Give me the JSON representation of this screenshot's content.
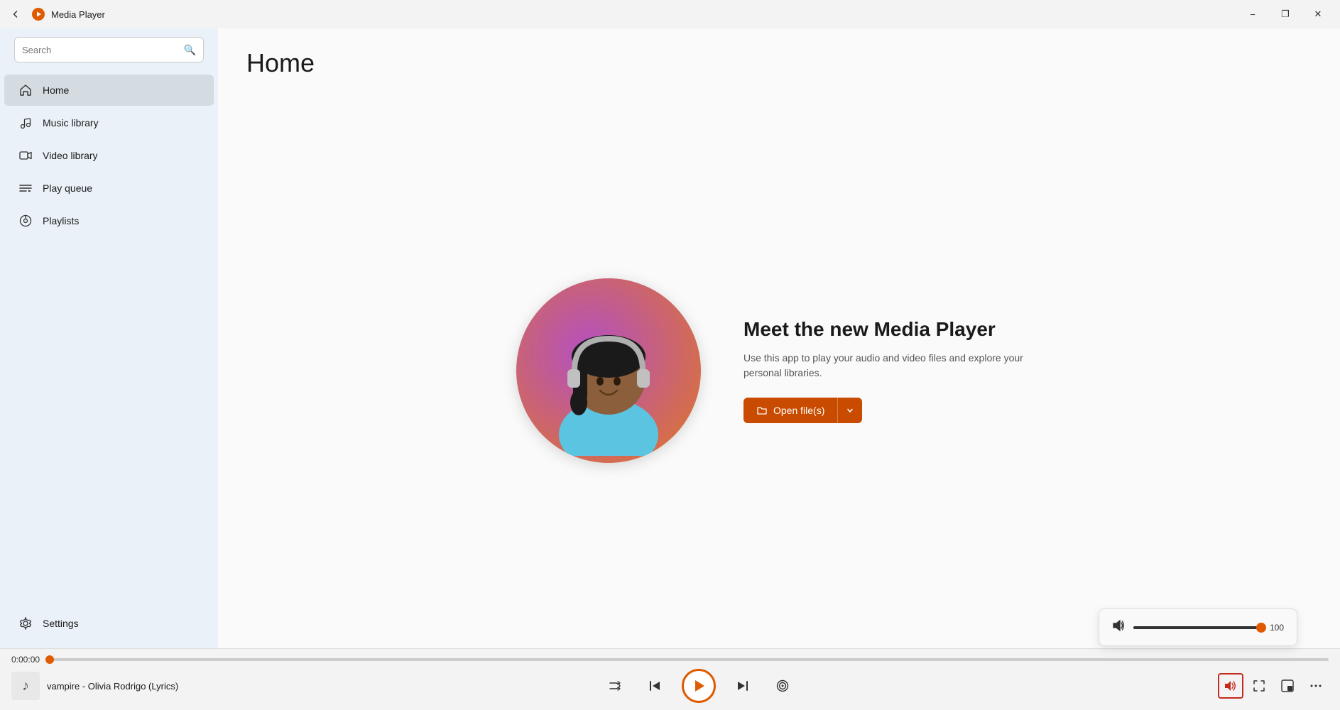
{
  "titlebar": {
    "title": "Media Player",
    "min_label": "−",
    "max_label": "❐",
    "close_label": "✕"
  },
  "sidebar": {
    "search_placeholder": "Search",
    "nav_items": [
      {
        "id": "home",
        "label": "Home",
        "icon": "🏠",
        "active": true
      },
      {
        "id": "music-library",
        "label": "Music library",
        "icon": "🎵",
        "active": false
      },
      {
        "id": "video-library",
        "label": "Video library",
        "icon": "🎞",
        "active": false
      },
      {
        "id": "play-queue",
        "label": "Play queue",
        "icon": "≡",
        "active": false
      },
      {
        "id": "playlists",
        "label": "Playlists",
        "icon": "⊙",
        "active": false
      }
    ],
    "settings_label": "Settings"
  },
  "main": {
    "page_title": "Home",
    "hero": {
      "heading": "Meet the new Media Player",
      "description": "Use this app to play your audio and video files and explore your personal libraries.",
      "open_files_label": "Open file(s)"
    }
  },
  "player": {
    "current_time": "0:00:00",
    "progress_percent": 0,
    "volume": 100,
    "now_playing": "vampire - Olivia Rodrigo (Lyrics)"
  }
}
